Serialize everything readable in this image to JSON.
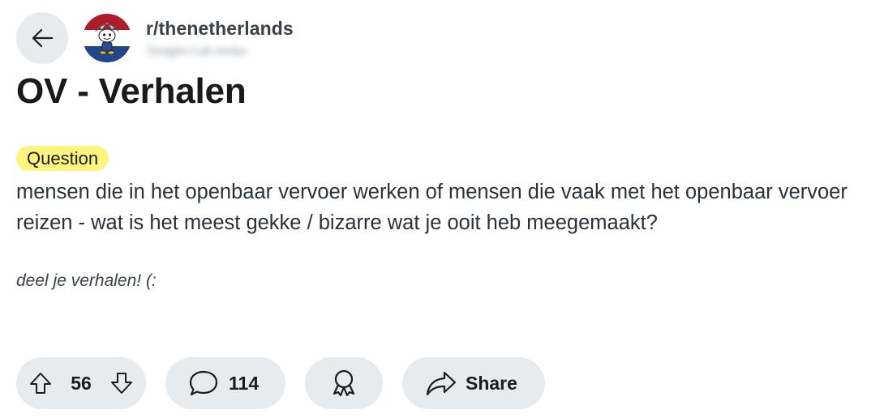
{
  "header": {
    "back_icon": "arrow-left-icon",
    "subreddit": "r/thenetherlands",
    "username": "Tonight-Cult-Ambo",
    "avatar_colors": [
      "#ae1c28",
      "#ffffff",
      "#21468b"
    ]
  },
  "post": {
    "title": "OV - Verhalen",
    "flair": "Question",
    "flair_color": "#fdf57d",
    "body": "mensen die in het openbaar vervoer werken of mensen die vaak met het openbaar vervoer reizen - wat is het meest gekke / bizarre wat je ooit heb meegemaakt?",
    "body_italic": "deel je verhalen! (:"
  },
  "actions": {
    "upvote_icon": "arrow-up-icon",
    "downvote_icon": "arrow-down-icon",
    "score": "56",
    "comment_icon": "comment-bubble-icon",
    "comments": "114",
    "award_icon": "award-icon",
    "share_icon": "share-arrow-icon",
    "share_label": "Share"
  }
}
